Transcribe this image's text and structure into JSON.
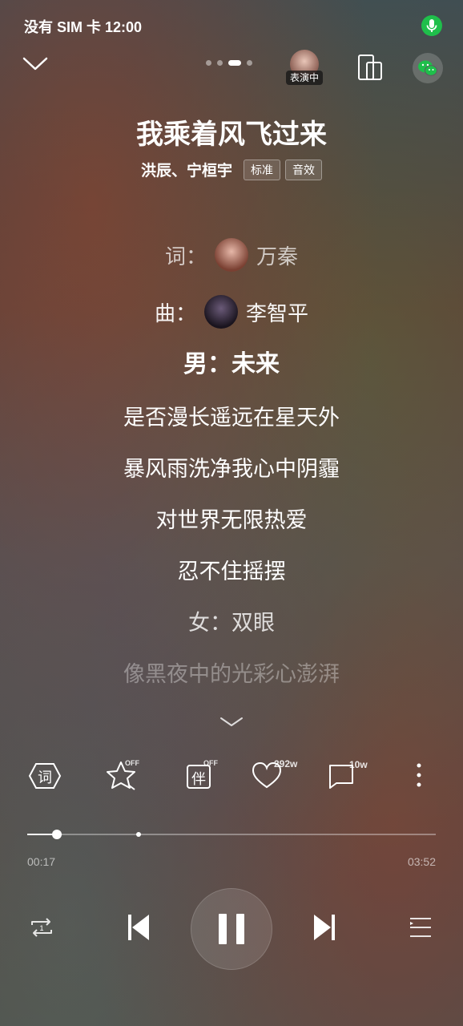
{
  "status_bar": {
    "carrier_time": "没有 SIM 卡 12:00"
  },
  "header": {
    "live_badge": "表演中",
    "page_dots": {
      "count": 4,
      "active": 3
    }
  },
  "song": {
    "title": "我乘着风飞过来",
    "artists": "洪辰、宁桓宇",
    "quality_tag": "标准",
    "effect_tag": "音效"
  },
  "lyrics": {
    "credits": [
      {
        "label": "词：",
        "name": "万秦"
      },
      {
        "label": "曲：",
        "name": "李智平"
      }
    ],
    "current_line": "男：未来",
    "lines": [
      "是否漫长遥远在星天外",
      "暴风雨洗净我心中阴霾",
      "对世界无限热爱",
      "忍不住摇摆",
      "女：双眼",
      "像黑夜中的光彩心澎湃"
    ]
  },
  "actions": {
    "lyrics_icon_label": "词",
    "accompany_icon_label": "伴",
    "star_badge": "OFF",
    "accompany_badge": "OFF",
    "like_count": "292w",
    "comment_count": "10w"
  },
  "progress": {
    "current": "00:17",
    "total": "03:52",
    "fraction": 0.073
  },
  "colors": {
    "accent_green": "#1fbf4b"
  }
}
